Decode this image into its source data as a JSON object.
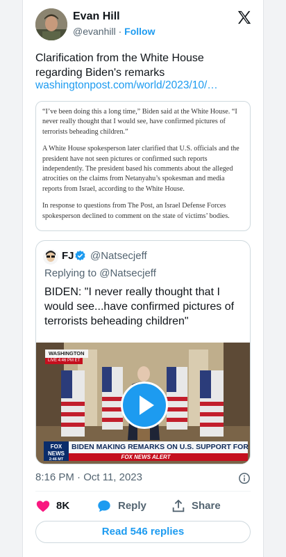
{
  "author": {
    "name": "Evan Hill",
    "handle": "@evanhill",
    "separator": "·",
    "follow_label": "Follow"
  },
  "tweet": {
    "text": "Clarification from the White House regarding Biden's remarks",
    "link": "washingtonpost.com/world/2023/10/…"
  },
  "article_excerpt": {
    "paragraphs": [
      "“I’ve been doing this a long time,” Biden said at the White House. “I never really thought that I would see, have confirmed pictures of terrorists beheading children.”",
      "A White House spokesperson later clarified that U.S. officials and the president have not seen pictures or confirmed such reports independently. The president based his comments about the alleged atrocities on the claims from Netanyahu’s spokesman and media reports from Israel, according to the White House.",
      "In response to questions from The Post, an Israel Defense Forces spokesperson declined to comment on the state of victims’ bodies."
    ]
  },
  "quoted_tweet": {
    "name": "FJ",
    "handle": "@Natsecjeff",
    "replying_to": "Replying to @Natsecjeff",
    "text": "BIDEN: \"I never really thought that I would see...have confirmed pictures of terrorists beheading children\"",
    "video": {
      "location_tag": "WASHINGTON",
      "live_tag": "LIVE  4:46 PM ET",
      "channel_logo_top": "FOX",
      "channel_logo_bottom": "NEWS",
      "channel_time": "2:46 MT",
      "headline": "BIDEN MAKING REMARKS ON U.S. SUPPORT FOR ISRAEL",
      "alert_bar": "FOX NEWS ALERT"
    }
  },
  "meta": {
    "time": "8:16 PM",
    "separator": "·",
    "date": "Oct 11, 2023"
  },
  "actions": {
    "likes": "8K",
    "reply_label": "Reply",
    "share_label": "Share"
  },
  "read_replies_label": "Read 546 replies",
  "colors": {
    "accent": "#1d9bf0",
    "like": "#f91880",
    "text": "#0f1419",
    "secondary": "#536471"
  },
  "icons": {
    "x_logo": "x-logo-icon",
    "verified": "verified-badge-icon",
    "like": "heart-icon",
    "reply": "speech-bubble-icon",
    "share": "share-upload-icon",
    "info": "info-icon",
    "play": "play-icon"
  }
}
